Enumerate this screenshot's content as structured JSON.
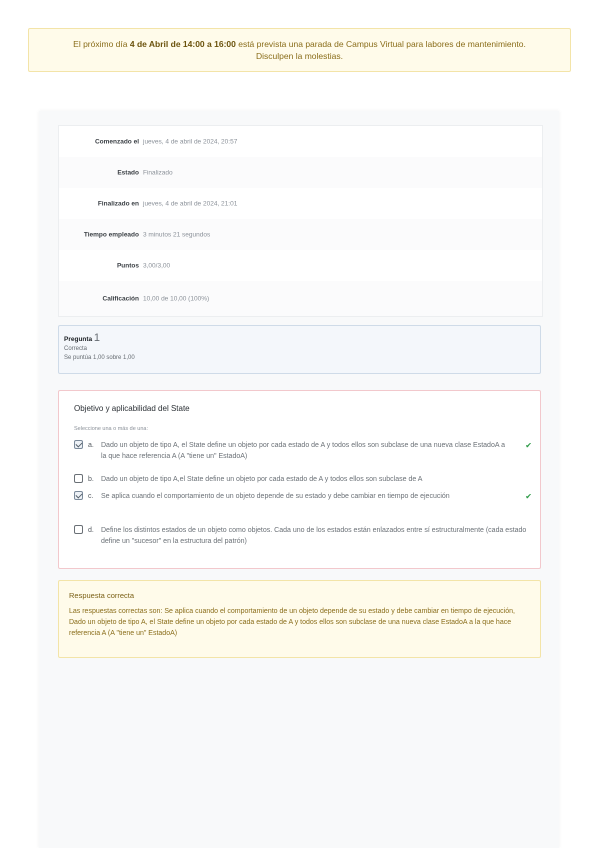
{
  "banner": {
    "pre": "El próximo día ",
    "bold": "4 de Abril de 14:00 a 16:00",
    "post": " está prevista una parada de Campus Virtual para labores de mantenimiento.",
    "line2": "Disculpen la molestias."
  },
  "summary": [
    {
      "label": "Comenzado el",
      "value": "jueves, 4 de abril de 2024, 20:57"
    },
    {
      "label": "Estado",
      "value": "Finalizado"
    },
    {
      "label": "Finalizado en",
      "value": "jueves, 4 de abril de 2024, 21:01"
    },
    {
      "label": "Tiempo empleado",
      "value": "3 minutos 21 segundos"
    },
    {
      "label": "Puntos",
      "value": "3,00/3,00"
    },
    {
      "label": "Calificación",
      "value": "10,00 de 10,00 (100%)"
    }
  ],
  "question": {
    "label": "Pregunta",
    "number": "1",
    "status": "Correcta",
    "score": "Se puntúa 1,00 sobre 1,00",
    "title": "Objetivo y aplicabilidad del State",
    "prompt": "Seleccione una o más de una:",
    "options": [
      {
        "letter": "a.",
        "text": "Dado un objeto de tipo A, el State define un objeto por cada estado de A y todos ellos son subclase de una nueva clase EstadoA a la que hace referencia A (A \"tiene un\" EstadoA)",
        "checked": true,
        "correct_mark": "✔"
      },
      {
        "letter": "b.",
        "text": "Dado un objeto de tipo A,el State define un objeto por cada estado de A y todos ellos son subclase de A",
        "checked": false,
        "correct_mark": ""
      },
      {
        "letter": "c.",
        "text": "Se aplica cuando el comportamiento de un objeto depende de su estado y debe cambiar en tiempo de ejecución",
        "checked": true,
        "correct_mark": "✔"
      },
      {
        "letter": "d.",
        "text": "Define los distintos estados de un objeto como objetos. Cada uno de los estados están enlazados entre sí estructuralmente (cada estado define un \"sucesor\" en la estructura del patrón)",
        "checked": false,
        "correct_mark": ""
      }
    ]
  },
  "feedback": {
    "heading": "Respuesta correcta",
    "text": "Las respuestas correctas son: Se aplica cuando el comportamiento de un objeto depende de su estado y debe cambiar en tiempo de ejecución, Dado un objeto de tipo A, el State define un objeto por cada estado de A y todos ellos son subclase de una nueva clase EstadoA a la que hace referencia A (A \"tiene un\" EstadoA)"
  }
}
